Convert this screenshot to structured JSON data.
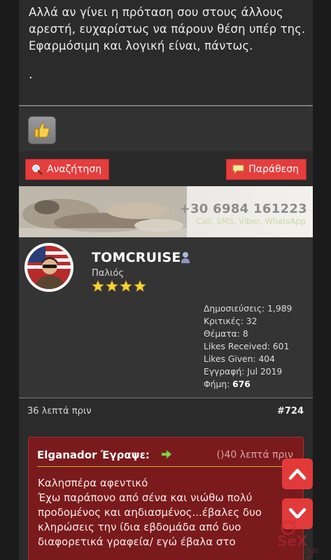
{
  "top_post": {
    "text": "Αλλά αν γίνει η πρόταση σου στους άλλους αρεστή, ευχαρίστως να πάρουν θέση υπέρ της. Εφαρμόσιμη και λογική είναι, πάντως.",
    "trailing": "."
  },
  "actions": {
    "search_label": "Αναζήτηση",
    "quote_label": "Παράθεση",
    "search_icon": "magnifier-icon",
    "quote_icon": "speech-bubble-icon"
  },
  "banner": {
    "phone": "+30 6984 161223",
    "subtitle": "Call, SMS, Viber, WhatsApp"
  },
  "profile": {
    "username": "TOMCRUISE",
    "rank": "Παλιός",
    "stars": 4,
    "stats": {
      "posts": "Δημοσιεύσεις: 1,989",
      "reviews": "Κριτικές: 32",
      "topics": "Θέματα: 8",
      "likes_received": "Likes Received: 601",
      "likes_given": "Likes Given: 404",
      "joined": "Εγγραφή: Jul 2019",
      "reputation_label": "Φήμη: ",
      "reputation_value": "676"
    }
  },
  "post_meta": {
    "time": "36 λεπτά πριν",
    "number": "#724"
  },
  "quote": {
    "author_line": "Elganador Έγραψε:",
    "time": "()40 λεπτά πριν",
    "body": "Καλησπέρα αφεντικό\nΈχω  παράπονο από σένα και νιώθω πολύ προδομένος και αηδιασμένος...έβαλες δυο κληρώσεις την ίδια  εβδομάδα από δυο διαφορετικά γραφεία/ εγώ έβαλα στο"
  },
  "colors": {
    "accent_red": "#e63d3d",
    "quote_bg": "#7a1a1c",
    "panel": "#2b2b2b"
  }
}
